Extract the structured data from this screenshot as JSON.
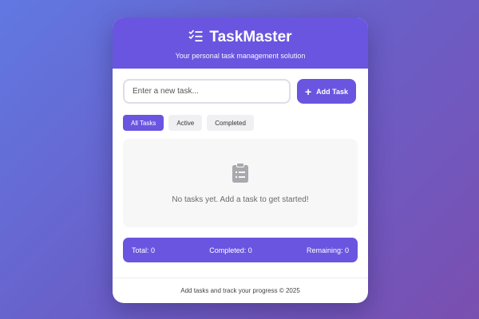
{
  "header": {
    "title": "TaskMaster",
    "subtitle": "Your personal task management solution",
    "icon": "task-list-icon"
  },
  "input": {
    "placeholder": "Enter a new task...",
    "value": ""
  },
  "add_button": {
    "label": "Add Task",
    "icon": "plus-icon"
  },
  "filters": [
    {
      "label": "All Tasks",
      "active": true
    },
    {
      "label": "Active",
      "active": false
    },
    {
      "label": "Completed",
      "active": false
    }
  ],
  "empty_state": {
    "icon": "clipboard-icon",
    "text": "No tasks yet. Add a task to get started!"
  },
  "stats": {
    "total": "Total: 0",
    "completed": "Completed: 0",
    "remaining": "Remaining: 0"
  },
  "footer": {
    "text": "Add tasks and track your progress © 2025"
  },
  "colors": {
    "accent": "#6a55e0",
    "background_start": "#6178e2",
    "background_end": "#7a4fb0"
  }
}
